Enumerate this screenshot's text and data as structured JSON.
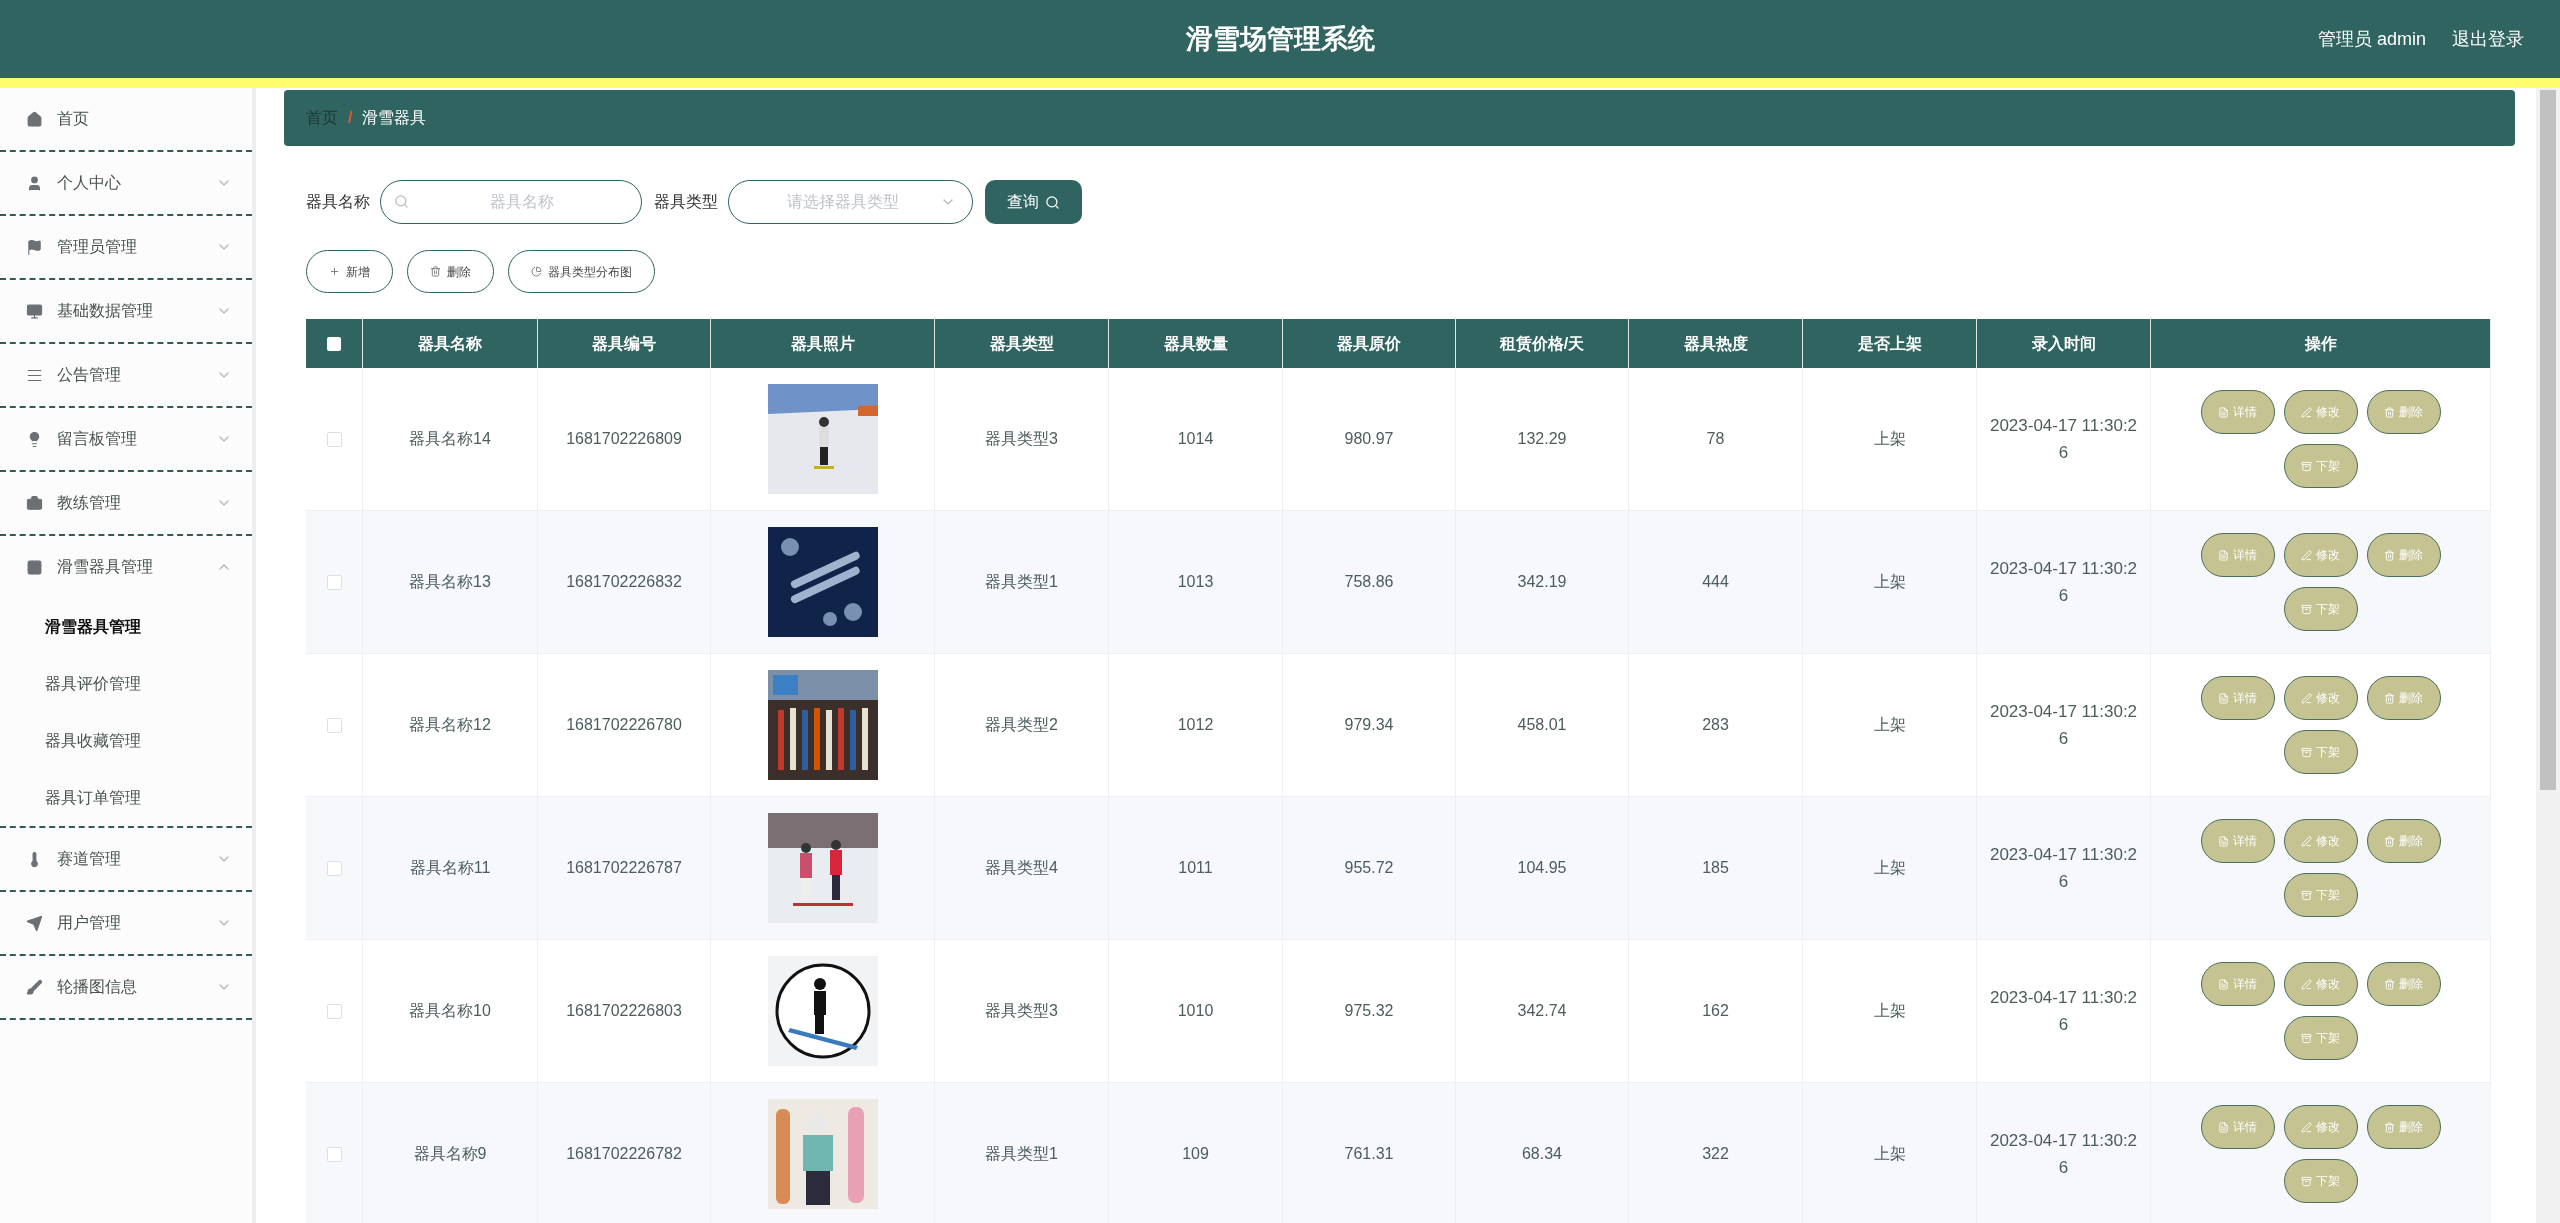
{
  "header": {
    "title": "滑雪场管理系统",
    "user": "管理员 admin",
    "logout": "退出登录"
  },
  "sidebar": {
    "items": [
      {
        "label": "首页"
      },
      {
        "label": "个人中心",
        "expanded": false
      },
      {
        "label": "管理员管理",
        "expanded": false
      },
      {
        "label": "基础数据管理",
        "expanded": false
      },
      {
        "label": "公告管理",
        "expanded": false
      },
      {
        "label": "留言板管理",
        "expanded": false
      },
      {
        "label": "教练管理",
        "expanded": false
      },
      {
        "label": "滑雪器具管理",
        "expanded": true,
        "children": [
          {
            "label": "滑雪器具管理",
            "selected": true
          },
          {
            "label": "器具评价管理",
            "selected": false
          },
          {
            "label": "器具收藏管理",
            "selected": false
          },
          {
            "label": "器具订单管理",
            "selected": false
          }
        ]
      },
      {
        "label": "赛道管理",
        "expanded": false
      },
      {
        "label": "用户管理",
        "expanded": false
      },
      {
        "label": "轮播图信息",
        "expanded": false
      }
    ]
  },
  "breadcrumb": [
    "首页",
    "/",
    "滑雪器具"
  ],
  "search": {
    "name_label": "器具名称",
    "name_placeholder": "器具名称",
    "type_label": "器具类型",
    "type_placeholder": "请选择器具类型",
    "button": "查询"
  },
  "toolbar": [
    {
      "label": "新增",
      "kind": "add"
    },
    {
      "label": "删除",
      "kind": "delete"
    },
    {
      "label": "器具类型分布图",
      "kind": "chart"
    }
  ],
  "table": {
    "all_checked": false,
    "columns": [
      "器具名称",
      "器具编号",
      "器具照片",
      "器具类型",
      "器具数量",
      "器具原价",
      "租赁价格/天",
      "器具热度",
      "是否上架",
      "录入时间",
      "操作"
    ],
    "rows": [
      {
        "checked": false,
        "cells": [
          "器具名称14",
          "1681702226809",
          {
            "kind": "picture"
          },
          "器具类型3",
          "1014",
          "980.97",
          "132.29",
          "78",
          "上架",
          "2023-04-17 11:30:26"
        ],
        "actions": [
          "详情",
          "修改",
          "删除",
          "下架"
        ]
      },
      {
        "checked": false,
        "cells": [
          "器具名称13",
          "1681702226832",
          {
            "kind": "picture"
          },
          "器具类型1",
          "1013",
          "758.86",
          "342.19",
          "444",
          "上架",
          "2023-04-17 11:30:26"
        ],
        "actions": [
          "详情",
          "修改",
          "删除",
          "下架"
        ]
      },
      {
        "checked": false,
        "cells": [
          "器具名称12",
          "1681702226780",
          {
            "kind": "picture"
          },
          "器具类型2",
          "1012",
          "979.34",
          "458.01",
          "283",
          "上架",
          "2023-04-17 11:30:26"
        ],
        "actions": [
          "详情",
          "修改",
          "删除",
          "下架"
        ]
      },
      {
        "checked": false,
        "cells": [
          "器具名称11",
          "1681702226787",
          {
            "kind": "picture"
          },
          "器具类型4",
          "1011",
          "955.72",
          "104.95",
          "185",
          "上架",
          "2023-04-17 11:30:26"
        ],
        "actions": [
          "详情",
          "修改",
          "删除",
          "下架"
        ]
      },
      {
        "checked": false,
        "cells": [
          "器具名称10",
          "1681702226803",
          {
            "kind": "picture"
          },
          "器具类型3",
          "1010",
          "975.32",
          "342.74",
          "162",
          "上架",
          "2023-04-17 11:30:26"
        ],
        "actions": [
          "详情",
          "修改",
          "删除",
          "下架"
        ]
      },
      {
        "checked": false,
        "cells": [
          "器具名称9",
          "1681702226782",
          {
            "kind": "picture"
          },
          "器具类型1",
          "109",
          "761.31",
          "68.34",
          "322",
          "上架",
          "2023-04-17 11:30:26"
        ],
        "actions": [
          "详情",
          "修改",
          "删除",
          "下架"
        ]
      }
    ]
  }
}
